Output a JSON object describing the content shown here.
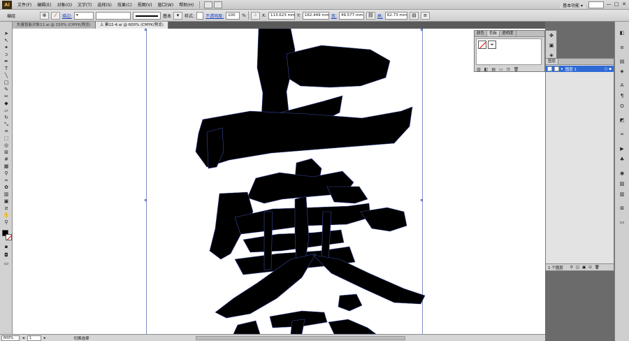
{
  "app": {
    "logo": "Ai",
    "menus": [
      "文件(F)",
      "编辑(E)",
      "对象(O)",
      "文字(T)",
      "选择(S)",
      "效果(C)",
      "视图(V)",
      "窗口(W)",
      "帮助(H)"
    ],
    "workspace": "基本功能 ▾",
    "window_controls": [
      "—",
      "□",
      "✕"
    ]
  },
  "control_bar": {
    "mode_label": "编组",
    "stroke_link": "描边:",
    "stroke_style_label": "基本",
    "style_label": "样式:",
    "opacity_link": "不透明度:",
    "opacity_value": "100",
    "opacity_unit": "%",
    "x_label": "X:",
    "x_value": "113.623 mm",
    "y_label": "Y:",
    "y_value": "162.449 mm",
    "w_label": "宽:",
    "w_value": "49.577 mm",
    "h_label": "高:",
    "h_value": "62.73 mm"
  },
  "tabs": [
    {
      "label": "失量智能对象11.ai @ 150% (CMYK/预览)",
      "active": false
    },
    {
      "label": "上 寨22-4.ai @ 600% (CMYK/预览)",
      "active": true
    }
  ],
  "tools": [
    "select-icon",
    "direct-select-icon",
    "magic-wand-icon",
    "lasso-icon",
    "pen-icon",
    "type-icon",
    "line-icon",
    "rectangle-icon",
    "paintbrush-icon",
    "pencil-icon",
    "blob-brush-icon",
    "eraser-icon",
    "rotate-icon",
    "scale-icon",
    "warp-icon",
    "free-transform-icon",
    "shape-builder-icon",
    "perspective-icon",
    "mesh-icon",
    "gradient-icon",
    "eyedropper-icon",
    "blend-icon",
    "symbol-sprayer-icon",
    "column-graph-icon",
    "artboard-icon",
    "slice-icon",
    "hand-icon",
    "zoom-icon"
  ],
  "color_panel": {
    "tabs": [
      "颜色",
      "色板",
      "透明度"
    ],
    "active_tab": 1
  },
  "layers_panel": {
    "tab": "图层",
    "layer_name": "图层 1",
    "footer_text": "1 个图层"
  },
  "status_bar": {
    "zoom": "600%",
    "artboard": "1",
    "status": "切换选择"
  },
  "colors": {
    "accent": "#2e6ad6",
    "link": "#1b47c9",
    "guide": "#7d8fc9"
  }
}
